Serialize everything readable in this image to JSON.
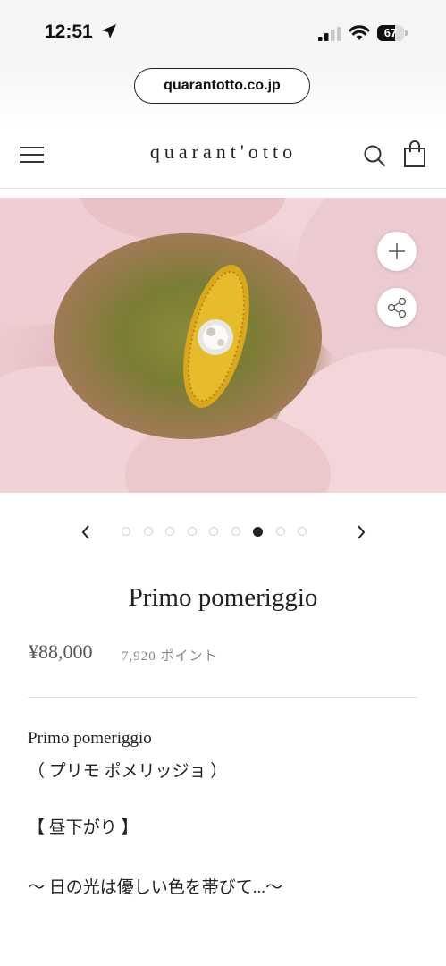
{
  "status_bar": {
    "time": "12:51",
    "battery": "67",
    "battery_level": 0.67,
    "icons": [
      "location-arrow-icon",
      "signal-icon",
      "wifi-icon",
      "battery-icon"
    ]
  },
  "browser": {
    "url": "quarantotto.co.jp"
  },
  "header": {
    "brand": "quarant'otto",
    "icons": [
      "menu-icon",
      "search-icon",
      "shopping-bag-icon"
    ]
  },
  "gallery": {
    "dot_count": 9,
    "active_index": 6,
    "buttons": [
      "zoom-plus-icon",
      "share-icon"
    ]
  },
  "product": {
    "title": "Primo pomeriggio",
    "price": "¥88,000",
    "points": "7,920 ポイント",
    "description": [
      "Primo pomeriggio",
      "（ プリモ ポメリッジョ ）",
      "【 昼下がり 】",
      "〜 日の光は優しい色を帯びて...〜"
    ]
  },
  "colors": {
    "accent": "#222222",
    "gold": "#d9a81f",
    "petal_pink": "#ecc6cb"
  }
}
